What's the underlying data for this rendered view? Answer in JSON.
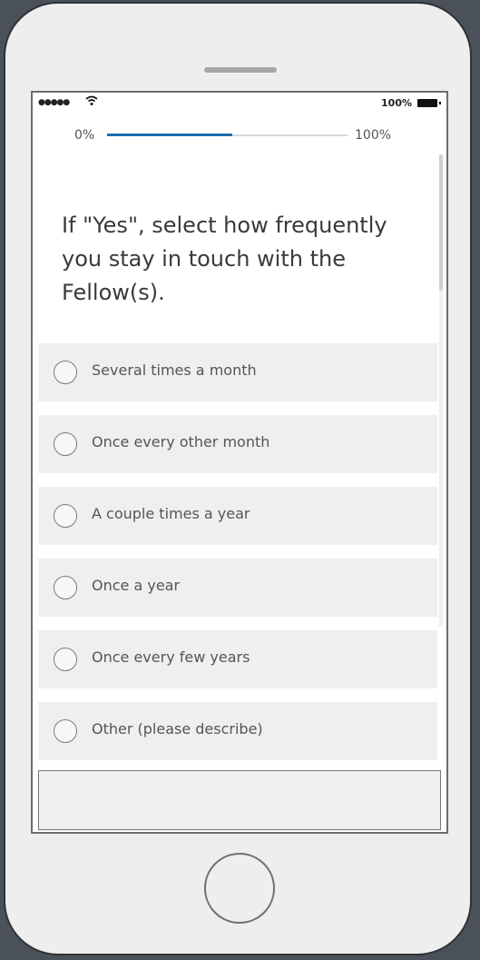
{
  "status_bar": {
    "signal": "●●●●●",
    "battery_percent": "100%"
  },
  "progress": {
    "start_label": "0%",
    "end_label": "100%",
    "fraction": 0.52
  },
  "question": {
    "text": "If \"Yes\", select how frequently you stay in touch with the Fellow(s)."
  },
  "options": [
    {
      "label": "Several times a month"
    },
    {
      "label": "Once every other month"
    },
    {
      "label": "A couple times a year"
    },
    {
      "label": "Once a year"
    },
    {
      "label": "Once every few years"
    },
    {
      "label": "Other (please describe)"
    }
  ],
  "other_text": {
    "value": ""
  },
  "colors": {
    "progress_fill": "#1f6fae",
    "device_background": "#4a5159"
  },
  "icons": {
    "wifi": "wifi-icon",
    "battery": "battery-icon",
    "home": "home-button"
  }
}
